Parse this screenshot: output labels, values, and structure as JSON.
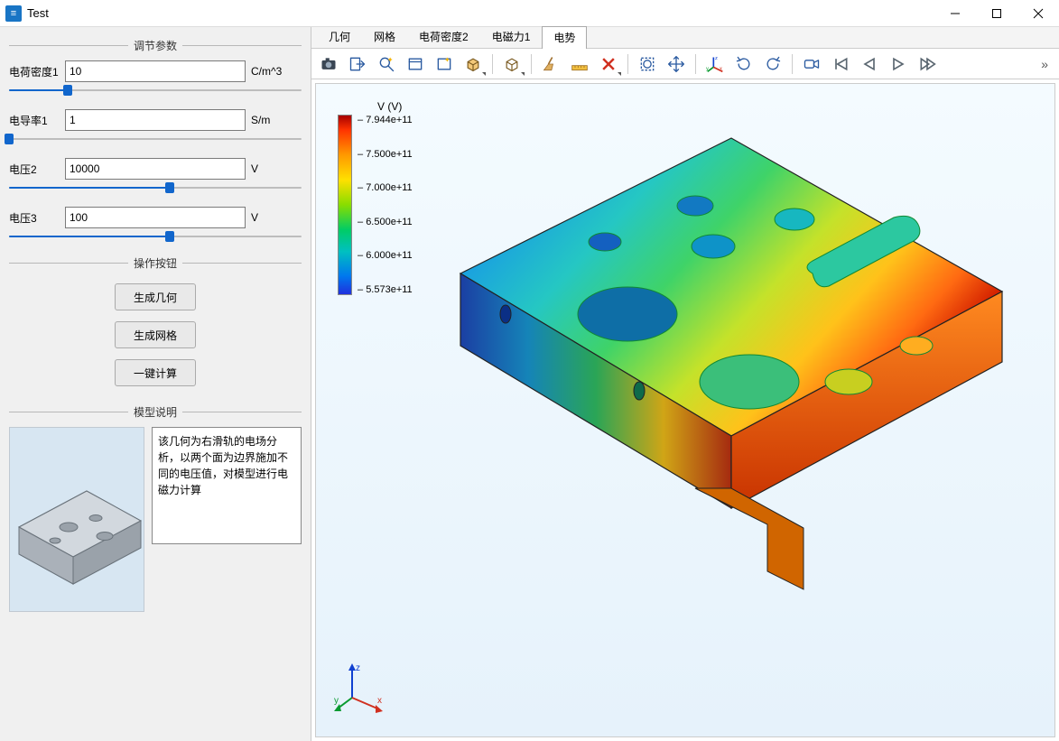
{
  "window": {
    "title": "Test"
  },
  "sidebar": {
    "group_params": "调节参数",
    "group_actions": "操作按钮",
    "group_desc": "模型说明",
    "params": [
      {
        "label": "电荷密度1",
        "value": "10",
        "unit": "C/m^3",
        "pct": 20
      },
      {
        "label": "电导率1",
        "value": "1",
        "unit": "S/m",
        "pct": 0
      },
      {
        "label": "电压2",
        "value": "10000",
        "unit": "V",
        "pct": 55
      },
      {
        "label": "电压3",
        "value": "100",
        "unit": "V",
        "pct": 55
      }
    ],
    "actions": [
      {
        "label": "生成几何"
      },
      {
        "label": "生成网格"
      },
      {
        "label": "一键计算"
      }
    ],
    "desc": "该几何为右滑轨的电场分析，以两个面为边界施加不同的电压值，对模型进行电磁力计算"
  },
  "tabs": [
    {
      "label": "几何",
      "active": false
    },
    {
      "label": "网格",
      "active": false
    },
    {
      "label": "电荷密度2",
      "active": false
    },
    {
      "label": "电磁力1",
      "active": false
    },
    {
      "label": "电势",
      "active": true
    }
  ],
  "toolbar_icons": [
    "camera-icon",
    "export-icon",
    "zoom-sparkle-icon",
    "window-icon",
    "brighten-icon",
    "cube-dd-icon",
    "",
    "cube-wire-dd-icon",
    "",
    "broom-icon",
    "ruler-icon",
    "delete-x-icon",
    "",
    "select-box-icon",
    "move-arrows-icon",
    "",
    "axes-xyz-icon",
    "rotate-ccw-icon",
    "rotate-cw-icon",
    "",
    "video-cam-icon",
    "skip-first-icon",
    "step-back-icon",
    "play-icon",
    "step-fwd-icon"
  ],
  "legend": {
    "title": "V (V)",
    "ticks": [
      "7.944e+11",
      "7.500e+11",
      "7.000e+11",
      "6.500e+11",
      "6.000e+11",
      "5.573e+11"
    ]
  },
  "triad": {
    "x": "x",
    "y": "y",
    "z": "z"
  },
  "chart_data": {
    "type": "heatmap",
    "title": "V (V)",
    "field": "Electric potential",
    "unit": "V",
    "range": [
      557300000000.0,
      794400000000.0
    ],
    "colorbar_ticks": [
      794400000000.0,
      750000000000.0,
      700000000000.0,
      650000000000.0,
      600000000000.0,
      557300000000.0
    ],
    "colormap": "rainbow",
    "view": "3D isometric surface plot on mechanical plate geometry"
  }
}
